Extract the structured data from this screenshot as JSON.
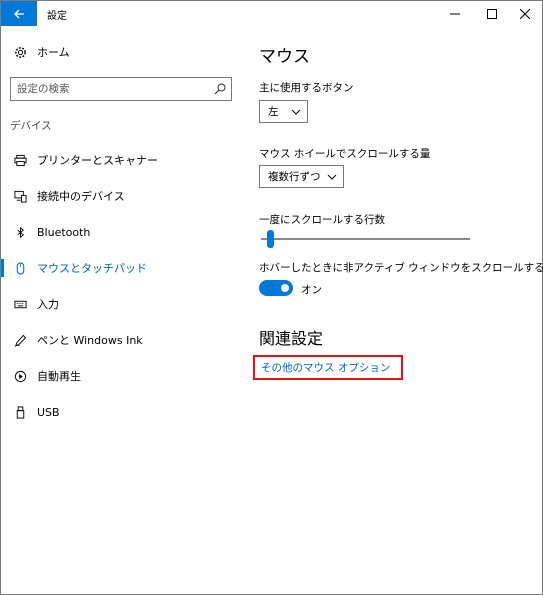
{
  "window": {
    "title": "設定",
    "controls": {
      "minimize": "minimize-icon",
      "maximize": "maximize-icon",
      "close": "close-icon"
    }
  },
  "sidebar": {
    "home_label": "ホーム",
    "search": {
      "placeholder": "設定の検索",
      "value": ""
    },
    "section_label": "デバイス",
    "items": [
      {
        "label": "プリンターとスキャナー",
        "icon": "printer-icon"
      },
      {
        "label": "接続中のデバイス",
        "icon": "devices-icon"
      },
      {
        "label": "Bluetooth",
        "icon": "bluetooth-icon"
      },
      {
        "label": "マウスとタッチパッド",
        "icon": "mouse-icon",
        "selected": true
      },
      {
        "label": "入力",
        "icon": "keyboard-icon"
      },
      {
        "label": "ペンと Windows Ink",
        "icon": "pen-icon"
      },
      {
        "label": "自動再生",
        "icon": "autoplay-icon"
      },
      {
        "label": "USB",
        "icon": "usb-icon"
      }
    ]
  },
  "main": {
    "title": "マウス",
    "primary_button": {
      "label": "主に使用するボタン",
      "value": "左"
    },
    "wheel_scroll": {
      "label": "マウス ホイールでスクロールする量",
      "value": "複数行ずつ"
    },
    "lines_to_scroll": {
      "label": "一度にスクロールする行数",
      "level": 0.03
    },
    "inactive_scroll": {
      "label": "ホバーしたときに非アクティブ ウィンドウをスクロールする",
      "state_label": "オン",
      "on": true
    },
    "related": {
      "title": "関連設定",
      "link": "その他のマウス オプション"
    }
  },
  "colors": {
    "accent": "#0078d7",
    "link": "#0063b1",
    "highlight_box": "#e8101a"
  }
}
